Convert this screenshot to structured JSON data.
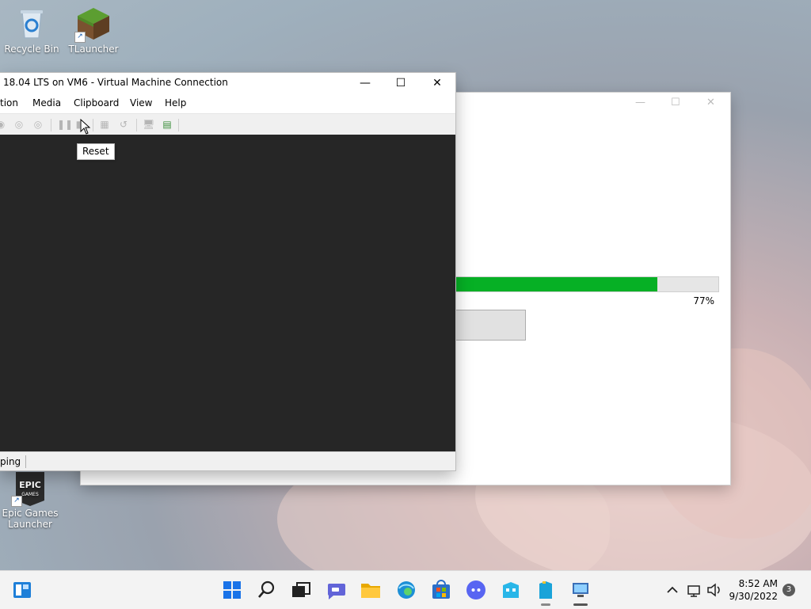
{
  "desktop": {
    "icons": [
      {
        "label": "Recycle Bin",
        "icon": "recycle-bin-icon"
      },
      {
        "label": "TLauncher",
        "icon": "grass-block-icon"
      },
      {
        "label": "Epic Games Launcher",
        "icon": "epic-games-icon",
        "logo_text": "EPIC GAMES"
      }
    ]
  },
  "installer_window": {
    "progress": {
      "value_percent": 77,
      "label": "77%"
    },
    "colors": {
      "progress_fill": "#06b025",
      "progress_track": "#e6e6e6"
    }
  },
  "vm_window": {
    "title": "18.04 LTS on VM6 - Virtual Machine Connection",
    "menu": [
      "tion",
      "Media",
      "Clipboard",
      "View",
      "Help"
    ],
    "status": "ping",
    "tooltip": "Reset",
    "colors": {
      "screen": "#262626",
      "titlebar": "#ffffff"
    }
  },
  "taskbar": {
    "apps": [
      "widgets-icon",
      "start-icon",
      "search-icon",
      "task-view-icon",
      "teams-chat-icon",
      "file-explorer-icon",
      "edge-icon",
      "store-icon",
      "discord-icon",
      "building-app-icon",
      "building-app-2-icon",
      "vm-connect-icon"
    ],
    "clock": {
      "time": "8:52 AM",
      "date": "9/30/2022"
    },
    "notification_count": "3"
  }
}
